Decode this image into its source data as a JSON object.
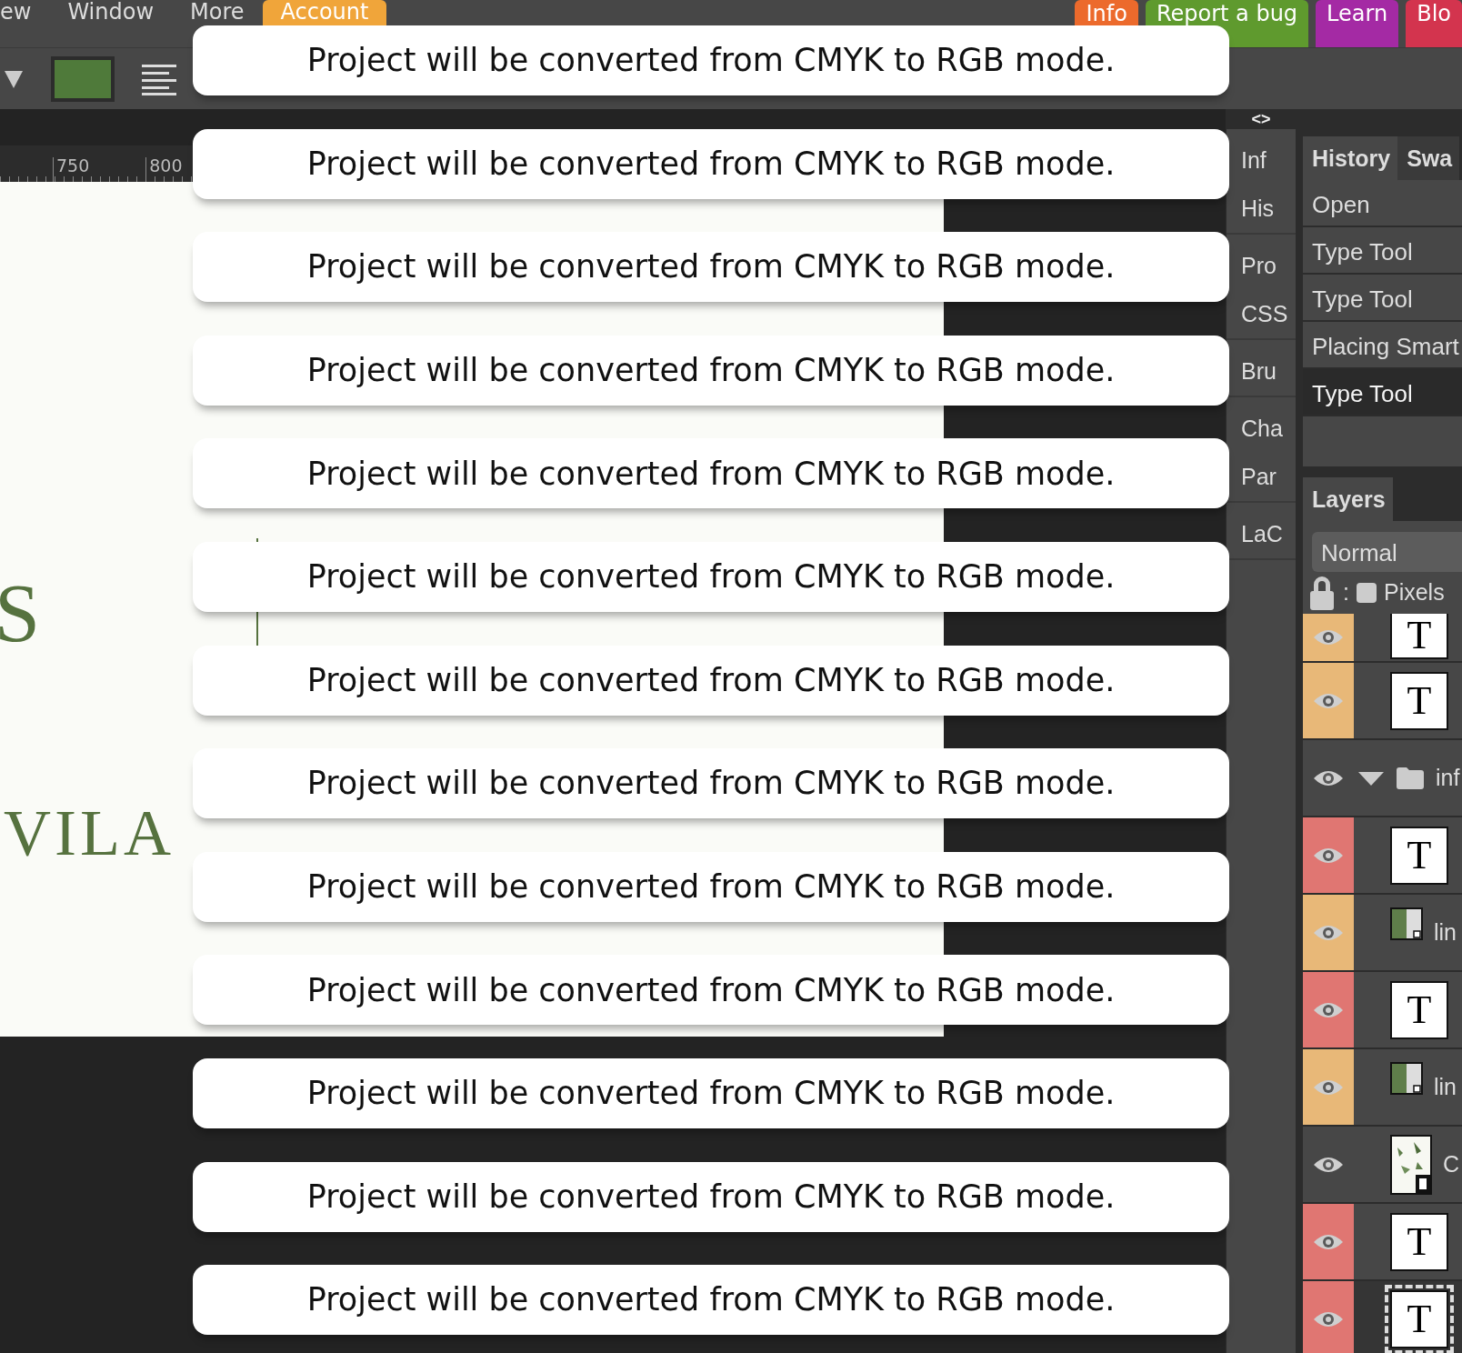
{
  "menu_bar": {
    "items": [
      {
        "label": "ew",
        "selected": false
      },
      {
        "label": "Window",
        "selected": false
      },
      {
        "label": "More",
        "selected": false
      },
      {
        "label": "Account",
        "selected": true
      }
    ],
    "buttons": [
      {
        "label": "Info",
        "color": "#ec6a2c"
      },
      {
        "label": "Report a bug",
        "color": "#5f9a2e"
      },
      {
        "label": "Learn",
        "color": "#a42aa4"
      },
      {
        "label": "Blo",
        "color": "#d3344e"
      }
    ]
  },
  "panel_toggle": "<>",
  "ruler": {
    "ticks": [
      "750",
      "800"
    ]
  },
  "canvas": {
    "texts": [
      "S",
      "VILA"
    ]
  },
  "panel_tabs": [
    [
      "Inf",
      "His"
    ],
    [
      "Pro",
      "CSS"
    ],
    [
      "Bru"
    ],
    [
      "Cha",
      "Par"
    ],
    [
      "LaC"
    ]
  ],
  "history": {
    "tabs": [
      {
        "label": "History",
        "selected": true
      },
      {
        "label": "Swa",
        "selected": false
      }
    ],
    "items": [
      {
        "label": "Open",
        "selected": false
      },
      {
        "label": "Type Tool",
        "selected": false
      },
      {
        "label": "Type Tool",
        "selected": false
      },
      {
        "label": "Placing Smart",
        "selected": false
      },
      {
        "label": "Type Tool",
        "selected": true
      }
    ]
  },
  "layers": {
    "tabs": [
      {
        "label": "Layers",
        "selected": true
      }
    ],
    "blend_mode": "Normal",
    "lock": {
      "separator": ":",
      "label": "Pixels",
      "checked": false
    },
    "rows": [
      {
        "kind": "text",
        "thumb": "T",
        "color": "#e8b878",
        "selected": false
      },
      {
        "kind": "text",
        "thumb": "T",
        "color": "#e8b878",
        "selected": false
      },
      {
        "kind": "folder",
        "label": "inf",
        "expanded": true,
        "selected": false
      },
      {
        "kind": "text",
        "thumb": "T",
        "color": "#e07672",
        "selected": false
      },
      {
        "kind": "shape",
        "label": "lin",
        "color": "#e8b878",
        "selected": false
      },
      {
        "kind": "text",
        "thumb": "T",
        "color": "#e07672",
        "selected": false
      },
      {
        "kind": "shape",
        "label": "lin",
        "color": "#e8b878",
        "selected": false
      },
      {
        "label": "C",
        "selected": false
      },
      {
        "kind": "text",
        "thumb": "T",
        "color": "#e07672",
        "selected": false
      },
      {
        "kind": "text",
        "thumb": "T",
        "color": "#e07672",
        "selected": true
      }
    ]
  },
  "toasts": [
    "Project will be converted from CMYK to RGB mode.",
    "Project will be converted from CMYK to RGB mode.",
    "Project will be converted from CMYK to RGB mode.",
    "Project will be converted from CMYK to RGB mode.",
    "Project will be converted from CMYK to RGB mode.",
    "Project will be converted from CMYK to RGB mode.",
    "Project will be converted from CMYK to RGB mode.",
    "Project will be converted from CMYK to RGB mode.",
    "Project will be converted from CMYK to RGB mode.",
    "Project will be converted from CMYK to RGB mode.",
    "Project will be converted from CMYK to RGB mode.",
    "Project will be converted from CMYK to RGB mode.",
    "Project will be converted from CMYK to RGB mode."
  ]
}
